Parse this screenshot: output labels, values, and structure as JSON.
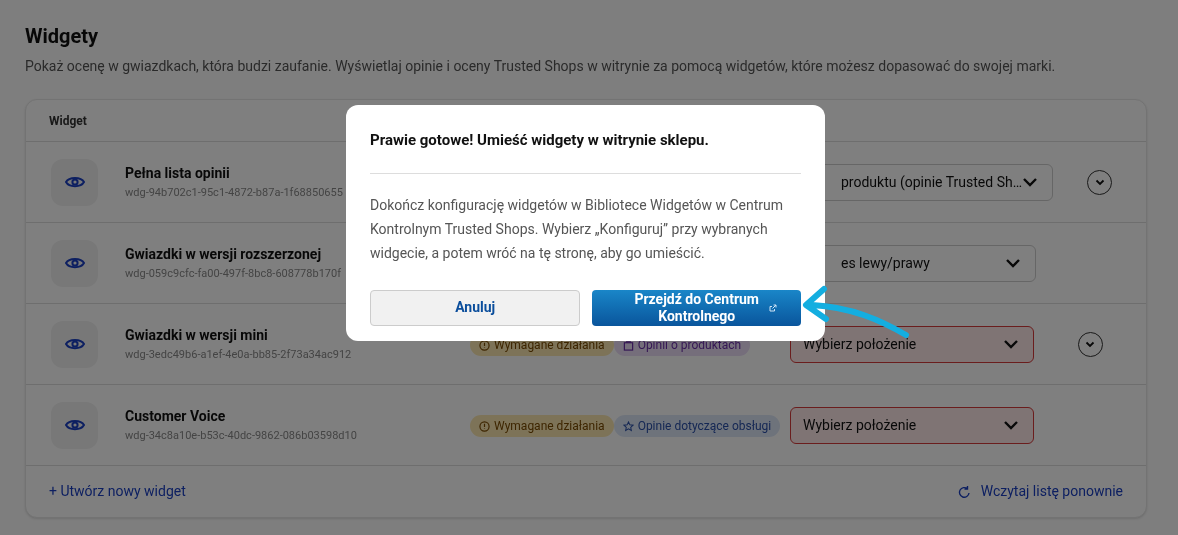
{
  "page": {
    "title": "Widgety",
    "description": "Pokaż ocenę w gwiazdkach, która budzi zaufanie. Wyświetlaj opinie i oceny Trusted Shops w witrynie za pomocą widgetów, które możesz dopasować do swojej marki."
  },
  "table": {
    "columns": [
      "Widget"
    ],
    "rows": [
      {
        "name": "Pełna lista opinii",
        "id": "wdg-94b702c1-95c1-4872-b87a-1f68850655",
        "badges": [],
        "position": "produktu (opinie Trusted Sh…",
        "error": false,
        "expandable": true
      },
      {
        "name": "Gwiazdki w wersji rozszerzonej",
        "id": "wdg-059c9cfc-fa00-497f-8bc8-608778b170f",
        "badges": [],
        "position": "es lewy/prawy",
        "error": false,
        "expandable": false
      },
      {
        "name": "Gwiazdki w wersji mini",
        "id": "wdg-3edc49b6-a1ef-4e0a-bb85-2f73a34ac912",
        "badges": [
          {
            "kind": "warning",
            "label": "Wymagane działania"
          },
          {
            "kind": "product",
            "label": "Opinii o produktach"
          }
        ],
        "position": "Wybierz położenie",
        "error": true,
        "expandable": true
      },
      {
        "name": "Customer Voice",
        "id": "wdg-34c8a10e-b53c-40dc-9862-086b03598d10",
        "badges": [
          {
            "kind": "warning",
            "label": "Wymagane działania"
          },
          {
            "kind": "service",
            "label": "Opinie dotyczące obsługi"
          }
        ],
        "position": "Wybierz położenie",
        "error": true,
        "expandable": false
      }
    ],
    "footer": {
      "create": "+ Utwórz nowy widget",
      "reload": "Wczytaj listę ponownie"
    }
  },
  "modal": {
    "title": "Prawie gotowe! Umieść widgety w witrynie sklepu.",
    "body": "Dokończ konfigurację widgetów w Bibliotece Widgetów w Centrum Kontrolnym Trusted Shops. Wybierz „Konfiguruj” przy wybranych widgecie, a potem wróć na tę stronę, aby go umieścić.",
    "cancel": "Anuluj",
    "confirm": "Przejdź do Centrum Kontrolnego"
  }
}
